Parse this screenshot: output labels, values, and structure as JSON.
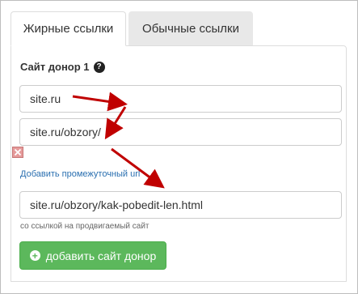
{
  "tabs": [
    {
      "label": "Жирные ссылки",
      "active": true
    },
    {
      "label": "Обычные ссылки",
      "active": false
    }
  ],
  "donor": {
    "title": "Сайт донор 1",
    "help_icon": "question-circle-icon"
  },
  "fields": [
    {
      "value": "site.ru"
    },
    {
      "value": "site.ru/obzory/"
    },
    {
      "value": "site.ru/obzory/kak-pobedit-len.html"
    }
  ],
  "remove_icon": "close-x-icon",
  "add_intermediate_url": "Добавить промежуточный url",
  "link_help_text": "со ссылкой на продвигаемый сайт",
  "add_donor_button": {
    "label": "добавить сайт донор",
    "icon": "plus-circle-icon"
  },
  "colors": {
    "accent_green": "#5cb85c",
    "link_blue": "#2a6fb0",
    "arrow_red": "#c00000"
  }
}
